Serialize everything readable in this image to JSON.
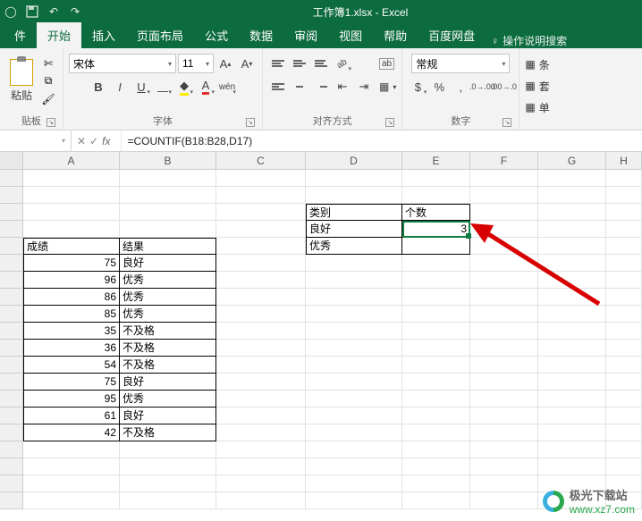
{
  "window": {
    "title": "工作簿1.xlsx - Excel"
  },
  "tabs": {
    "file": "件",
    "home": "开始",
    "insert": "插入",
    "layout": "页面布局",
    "formulas": "公式",
    "data": "数据",
    "review": "审阅",
    "view": "视图",
    "help": "帮助",
    "baidu": "百度网盘",
    "tellme": "操作说明搜索"
  },
  "ribbon": {
    "clipboard": {
      "paste": "粘贴",
      "label": "贴板"
    },
    "font": {
      "name": "宋体",
      "size": "11",
      "label": "字体"
    },
    "align": {
      "wrap": "ab",
      "merge": "",
      "label": "对齐方式"
    },
    "number": {
      "format": "常规",
      "label": "数字"
    },
    "styles": {
      "cond": "条",
      "table": "套",
      "cell": "单"
    }
  },
  "namebox": "",
  "formula": "=COUNTIF(B18:B28,D17)",
  "columns": [
    "A",
    "B",
    "C",
    "D",
    "E",
    "F",
    "G",
    "H"
  ],
  "chart_data": {
    "type": "table",
    "main_table": {
      "headers": [
        "成绩",
        "结果"
      ],
      "rows": [
        {
          "score": 75,
          "result": "良好"
        },
        {
          "score": 96,
          "result": "优秀"
        },
        {
          "score": 86,
          "result": "优秀"
        },
        {
          "score": 85,
          "result": "优秀"
        },
        {
          "score": 35,
          "result": "不及格"
        },
        {
          "score": 36,
          "result": "不及格"
        },
        {
          "score": 54,
          "result": "不及格"
        },
        {
          "score": 75,
          "result": "良好"
        },
        {
          "score": 95,
          "result": "优秀"
        },
        {
          "score": 61,
          "result": "良好"
        },
        {
          "score": 42,
          "result": "不及格"
        }
      ]
    },
    "summary_table": {
      "headers": [
        "类别",
        "个数"
      ],
      "rows": [
        {
          "cat": "良好",
          "count": 3
        },
        {
          "cat": "优秀",
          "count": ""
        }
      ]
    }
  },
  "watermark": {
    "cn": "极光下载站",
    "url": "www.xz7.com"
  }
}
